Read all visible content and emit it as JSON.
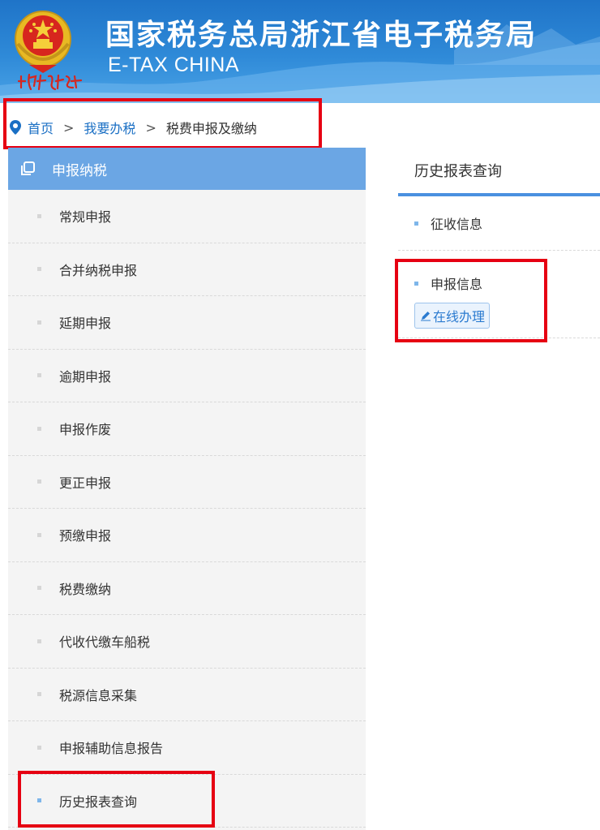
{
  "header": {
    "title": "国家税务总局浙江省电子税务局",
    "subtitle": "E-TAX CHINA",
    "emblem_icon": "national-emblem",
    "signature_text": "中国税务"
  },
  "breadcrumb": {
    "icon": "location-pin-icon",
    "home": "首页",
    "separator": ">",
    "level2": "我要办税",
    "current": "税费申报及缴纳"
  },
  "sidebar": {
    "header_icon": "square-outline-icon",
    "header": "申报纳税",
    "items": [
      {
        "label": "常规申报"
      },
      {
        "label": "合并纳税申报"
      },
      {
        "label": "延期申报"
      },
      {
        "label": "逾期申报"
      },
      {
        "label": "申报作废"
      },
      {
        "label": "更正申报"
      },
      {
        "label": "预缴申报"
      },
      {
        "label": "税费缴纳"
      },
      {
        "label": "代收代缴车船税"
      },
      {
        "label": "税源信息采集"
      },
      {
        "label": "申报辅助信息报告"
      },
      {
        "label": "历史报表查询",
        "active": true
      }
    ]
  },
  "main": {
    "tab_title": "历史报表查询",
    "rows": [
      {
        "label": "征收信息"
      },
      {
        "label": "申报信息",
        "button": "在线办理",
        "button_icon": "pencil-icon"
      }
    ]
  },
  "colors": {
    "banner_blue": "#2f8ad8",
    "sidebar_header": "#6ba6e4",
    "link_blue": "#1a6fc4",
    "highlight_red": "#e60012",
    "tab_underline": "#4a90e0"
  }
}
